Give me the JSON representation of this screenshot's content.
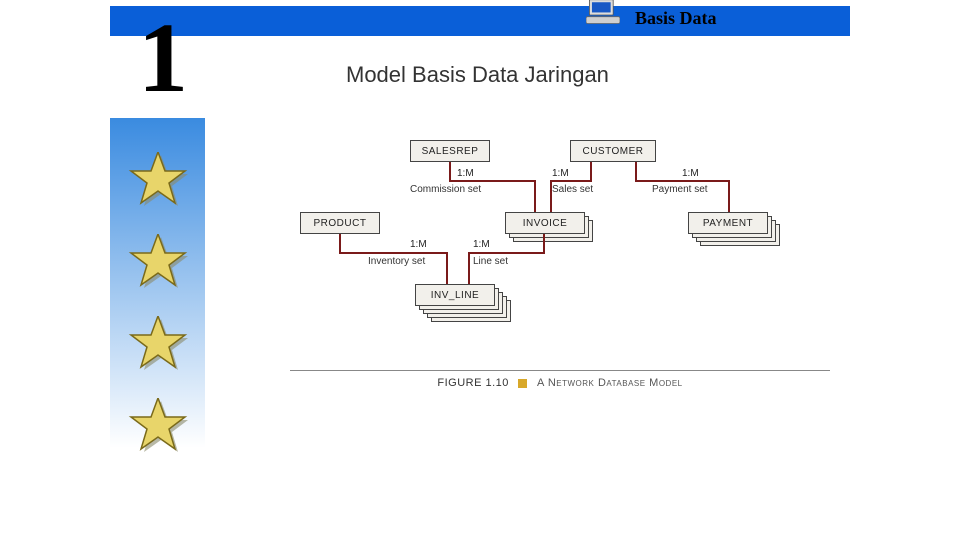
{
  "header": {
    "title": "Basis Data",
    "icon": "computer-icon"
  },
  "slide_number": "1",
  "subtitle": "Model Basis Data Jaringan",
  "stars": 4,
  "diagram": {
    "boxes": {
      "salesrep": "SALESREP",
      "customer": "CUSTOMER",
      "product": "PRODUCT",
      "invoice": "INVOICE",
      "payment": "PAYMENT",
      "inv_line": "INV_LINE"
    },
    "links": {
      "commission": {
        "ratio": "1:M",
        "label": "Commission set"
      },
      "sales": {
        "ratio": "1:M",
        "label": "Sales set"
      },
      "payment": {
        "ratio": "1:M",
        "label": "Payment set"
      },
      "inventory": {
        "ratio": "1:M",
        "label": "Inventory set"
      },
      "line": {
        "ratio": "1:M",
        "label": "Line set"
      }
    },
    "figure_caption": {
      "lead": "FIGURE 1.10",
      "main": "A Network Database Model"
    }
  },
  "chart_data": {
    "type": "table",
    "title": "Network Database Model — entities and set relationships",
    "entities": [
      "SALESREP",
      "CUSTOMER",
      "PRODUCT",
      "INVOICE",
      "PAYMENT",
      "INV_LINE"
    ],
    "relationships": [
      {
        "from": "SALESREP",
        "to": "INVOICE",
        "name": "Commission set",
        "cardinality": "1:M"
      },
      {
        "from": "CUSTOMER",
        "to": "INVOICE",
        "name": "Sales set",
        "cardinality": "1:M"
      },
      {
        "from": "CUSTOMER",
        "to": "PAYMENT",
        "name": "Payment set",
        "cardinality": "1:M"
      },
      {
        "from": "PRODUCT",
        "to": "INV_LINE",
        "name": "Inventory set",
        "cardinality": "1:M"
      },
      {
        "from": "INVOICE",
        "to": "INV_LINE",
        "name": "Line set",
        "cardinality": "1:M"
      }
    ]
  }
}
